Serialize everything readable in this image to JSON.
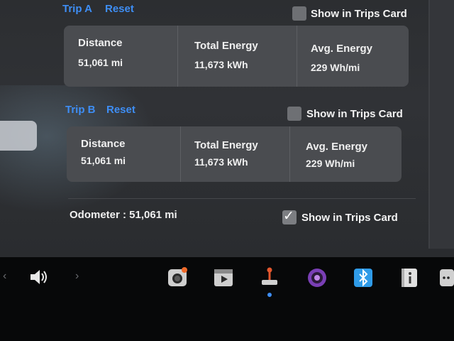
{
  "trip_a": {
    "label": "Trip A",
    "reset_label": "Reset",
    "show_in_trips_card": false,
    "show_in_trips_card_label": "Show in Trips Card",
    "distance_title": "Distance",
    "distance_value": "51,061 mi",
    "total_energy_title": "Total Energy",
    "total_energy_value": "11,673 kWh",
    "avg_energy_title": "Avg. Energy",
    "avg_energy_value": "229 Wh/mi"
  },
  "trip_b": {
    "label": "Trip B",
    "reset_label": "Reset",
    "show_in_trips_card": false,
    "show_in_trips_card_label": "Show in Trips Card",
    "distance_title": "Distance",
    "distance_value": "51,061 mi",
    "total_energy_title": "Total Energy",
    "total_energy_value": "11,673 kWh",
    "avg_energy_title": "Avg. Energy",
    "avg_energy_value": "229 Wh/mi"
  },
  "odometer": {
    "text": "Odometer : 51,061 mi",
    "show_in_trips_card": true,
    "show_in_trips_card_label": "Show in Trips Card"
  },
  "taskbar": {
    "left_arrow": "‹",
    "right_arrow": "›",
    "icons": [
      "volume-icon",
      "camera-icon",
      "media-player-icon",
      "joystick-icon",
      "theater-icon",
      "bluetooth-icon",
      "manual-icon",
      "more-icon"
    ],
    "active_icon": "joystick-icon"
  },
  "colors": {
    "accent": "#3e8ef5",
    "panel": "#2e3034",
    "card": "#4a4c50",
    "taskbar": "#070809"
  }
}
